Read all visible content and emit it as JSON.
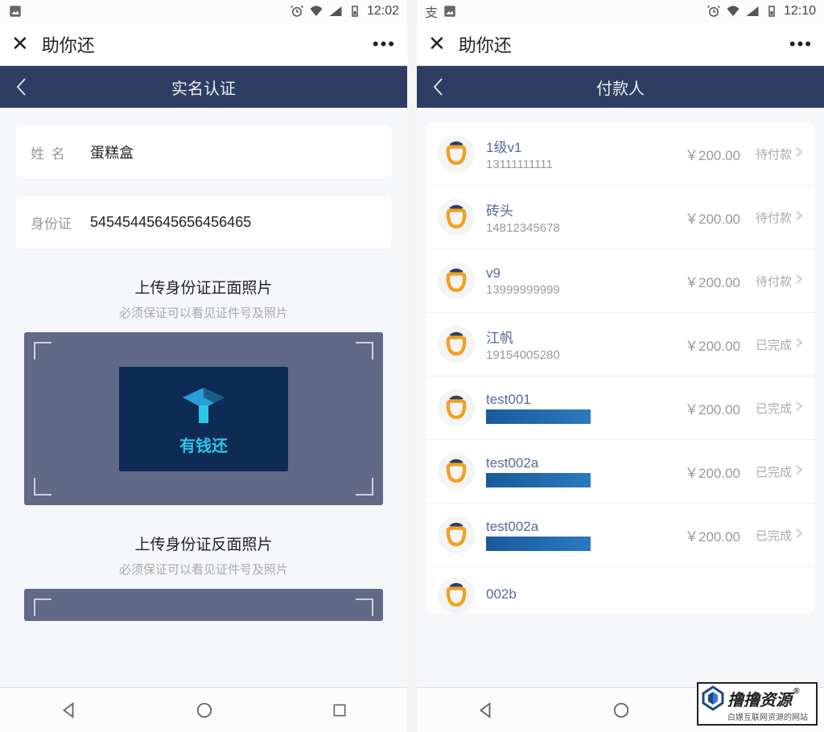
{
  "left": {
    "status_time": "12:02",
    "app_title": "助你还",
    "nav_title": "实名认证",
    "name_label": "姓 名",
    "name_value": "蛋糕盒",
    "id_label": "身份证",
    "id_value": "54545445645656456465",
    "upload_front_title": "上传身份证正面照片",
    "upload_front_sub": "必须保证可以看见证件号及照片",
    "logo_text": "有钱还",
    "upload_back_title": "上传身份证反面照片",
    "upload_back_sub": "必须保证可以看见证件号及照片"
  },
  "right": {
    "status_time": "12:10",
    "app_title": "助你还",
    "nav_title": "付款人",
    "rows": [
      {
        "name": "1级v1",
        "phone": "13111111111",
        "amount": "￥200.00",
        "status": "待付款",
        "masked": false
      },
      {
        "name": "砖头",
        "phone": "14812345678",
        "amount": "￥200.00",
        "status": "待付款",
        "masked": false
      },
      {
        "name": "v9",
        "phone": "13999999999",
        "amount": "￥200.00",
        "status": "待付款",
        "masked": false
      },
      {
        "name": "江帆",
        "phone": "19154005280",
        "amount": "￥200.00",
        "status": "已完成",
        "masked": false
      },
      {
        "name": "test001",
        "phone": "",
        "amount": "￥200.00",
        "status": "已完成",
        "masked": true
      },
      {
        "name": "test002a",
        "phone": "",
        "amount": "￥200.00",
        "status": "已完成",
        "masked": true
      },
      {
        "name": "test002a",
        "phone": "",
        "amount": "￥200.00",
        "status": "已完成",
        "masked": true
      }
    ],
    "partial_name": "002b"
  },
  "watermark": {
    "main": "撸撸资源",
    "sub": "白嫖互联网资源的网站"
  }
}
